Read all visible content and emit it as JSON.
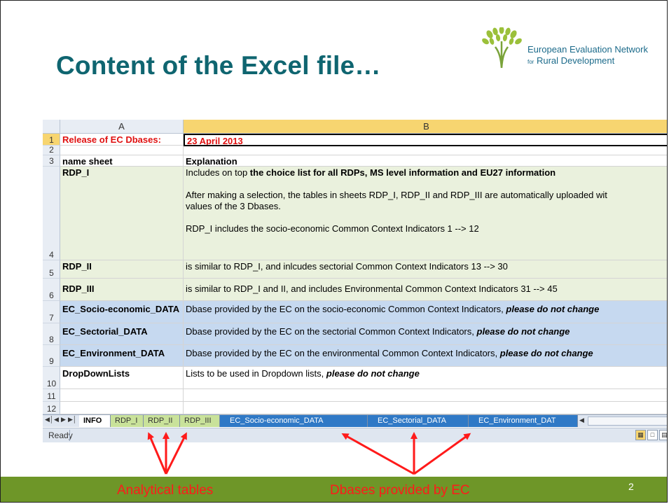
{
  "slide": {
    "title": "Content of the Excel file…",
    "logo": {
      "line1": "European Evaluation Network",
      "line2_small": "for",
      "line2": "Rural Development"
    },
    "page_number": "2",
    "footer_left": "Analytical tables",
    "footer_right": "Dbases provided by EC",
    "colors": {
      "title": "#0f6570",
      "footer_bg": "#6e9628",
      "annotation": "#ff1a1a"
    }
  },
  "excel": {
    "col_headers": [
      "A",
      "B"
    ],
    "rows": [
      {
        "num": "1",
        "a": "Release of EC Dbases:",
        "b": "23 April 2013"
      },
      {
        "num": "2",
        "a": "",
        "b": ""
      },
      {
        "num": "3",
        "a": "name sheet",
        "b": "Explanation"
      },
      {
        "num": "4",
        "a": "RDP_I",
        "b_line1_pre": "Includes on top ",
        "b_line1_bold": "the choice list for all RDPs, MS level information and EU27 information",
        "b_line2": "After making a selection, the tables in sheets RDP_I, RDP_II and RDP_III are automatically uploaded wit",
        "b_line3": "values of the 3 Dbases.",
        "b_line4": "RDP_I includes the socio-economic Common Context Indicators 1 --> 12"
      },
      {
        "num": "5",
        "a": "RDP_II",
        "b": "is similar to RDP_I, and inlcudes sectorial Common Context Indicators 13 --> 30"
      },
      {
        "num": "6",
        "a": "RDP_III",
        "b": "is similar to RDP_I and II, and includes Environmental Common Context Indicators 31 --> 45"
      },
      {
        "num": "7",
        "a": "EC_Socio-economic_DATA",
        "b": "Dbase provided by the EC on the socio-economic Common Context Indicators, ",
        "b_em": "please do not change"
      },
      {
        "num": "8",
        "a": "EC_Sectorial_DATA",
        "b": "Dbase provided by the EC on the sectorial Common Context Indicators, ",
        "b_em": "please do not change"
      },
      {
        "num": "9",
        "a": "EC_Environment_DATA",
        "b": "Dbase provided by the EC on the environmental Common Context Indicators, ",
        "b_em": "please do not change"
      },
      {
        "num": "10",
        "a": "DropDownLists",
        "b": "Lists to be used in Dropdown lists, ",
        "b_em": "please do not change"
      },
      {
        "num": "11",
        "a": "",
        "b": ""
      },
      {
        "num": "12",
        "a": "",
        "b": ""
      }
    ],
    "tabs": [
      "INFO",
      "RDP_I",
      "RDP_II",
      "RDP_III",
      "EC_Socio-economic_DATA",
      "EC_Sectorial_DATA",
      "EC_Environment_DAT"
    ],
    "nav_buttons": [
      "first-sheet",
      "prev-sheet",
      "next-sheet",
      "last-sheet"
    ],
    "status": "Ready"
  }
}
